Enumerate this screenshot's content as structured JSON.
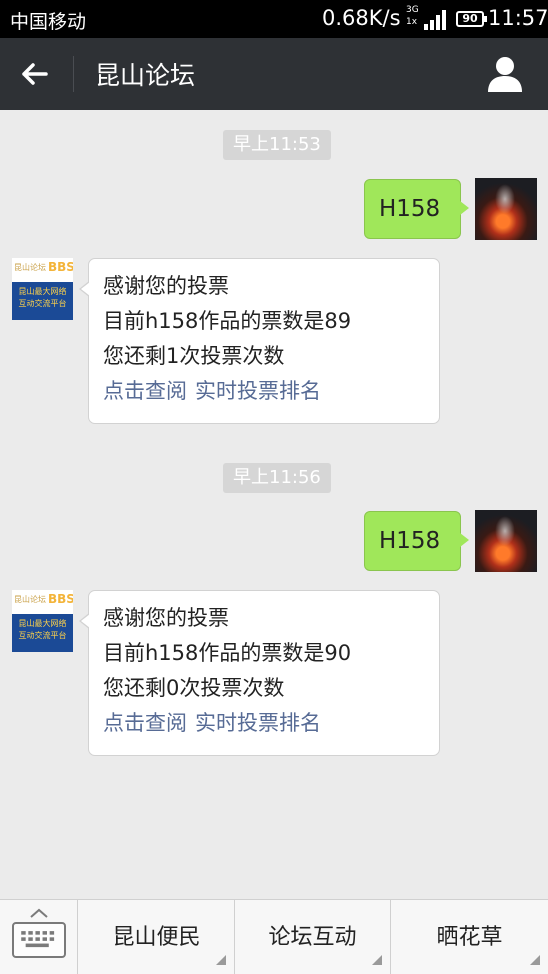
{
  "status_bar": {
    "carrier": "中国移动",
    "speed": "0.68K/s",
    "network_top": "3G",
    "network_bottom": "1x",
    "battery": "90",
    "time": "11:57"
  },
  "header": {
    "title": "昆山论坛",
    "back_icon": "arrow-left-icon",
    "profile_icon": "person-icon"
  },
  "messages": [
    {
      "time": "早上11:53",
      "sent": "H158",
      "reply": {
        "line1": "感谢您的投票",
        "line2": "目前h158作品的票数是89",
        "line3": "您还剩1次投票次数",
        "link1": "点击查阅",
        "link2": "实时投票排名"
      }
    },
    {
      "time": "早上11:56",
      "sent": "H158",
      "reply": {
        "line1": "感谢您的投票",
        "line2": "目前h158作品的票数是90",
        "line3": "您还剩0次投票次数",
        "link1": "点击查阅",
        "link2": "实时投票排名"
      }
    }
  ],
  "avatar_logo": {
    "bbs": "BBS",
    "line1": "昆山论坛",
    "blue_line1": "昆山最大网络",
    "blue_line2": "互动交流平台"
  },
  "bottom_menu": {
    "keyboard_icon": "keyboard-icon",
    "items": [
      "昆山便民",
      "论坛互动",
      "晒花草"
    ]
  },
  "colors": {
    "title_bar": "#2e3135",
    "green_bubble": "#a0e75a",
    "link": "#576b95",
    "background": "#ebebeb"
  }
}
